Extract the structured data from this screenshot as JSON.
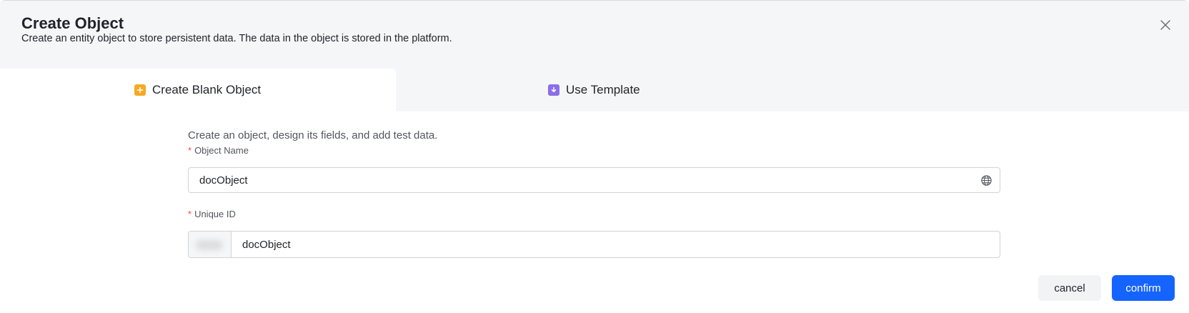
{
  "dialog": {
    "title": "Create Object",
    "subtitle": "Create an entity object to store persistent data. The data in the object is stored in the platform.",
    "close_icon": "close-icon"
  },
  "tabs": [
    {
      "label": "Create Blank Object",
      "icon": "plus-square-icon",
      "active": true,
      "icon_color": "#f7a823"
    },
    {
      "label": "Use Template",
      "icon": "download-square-icon",
      "active": false,
      "icon_color": "#8b6ee8"
    }
  ],
  "form": {
    "description": "Create an object, design its fields, and add test data.",
    "object_name": {
      "label": "Object Name",
      "required_mark": "*",
      "value": "docObject",
      "suffix_icon": "globe-icon"
    },
    "unique_id": {
      "label": "Unique ID",
      "required_mark": "*",
      "value": "docObject"
    }
  },
  "footer": {
    "cancel_label": "cancel",
    "confirm_label": "confirm"
  },
  "colors": {
    "primary": "#1664ff",
    "required": "#f54a45",
    "header_bg": "#f5f6f8"
  }
}
